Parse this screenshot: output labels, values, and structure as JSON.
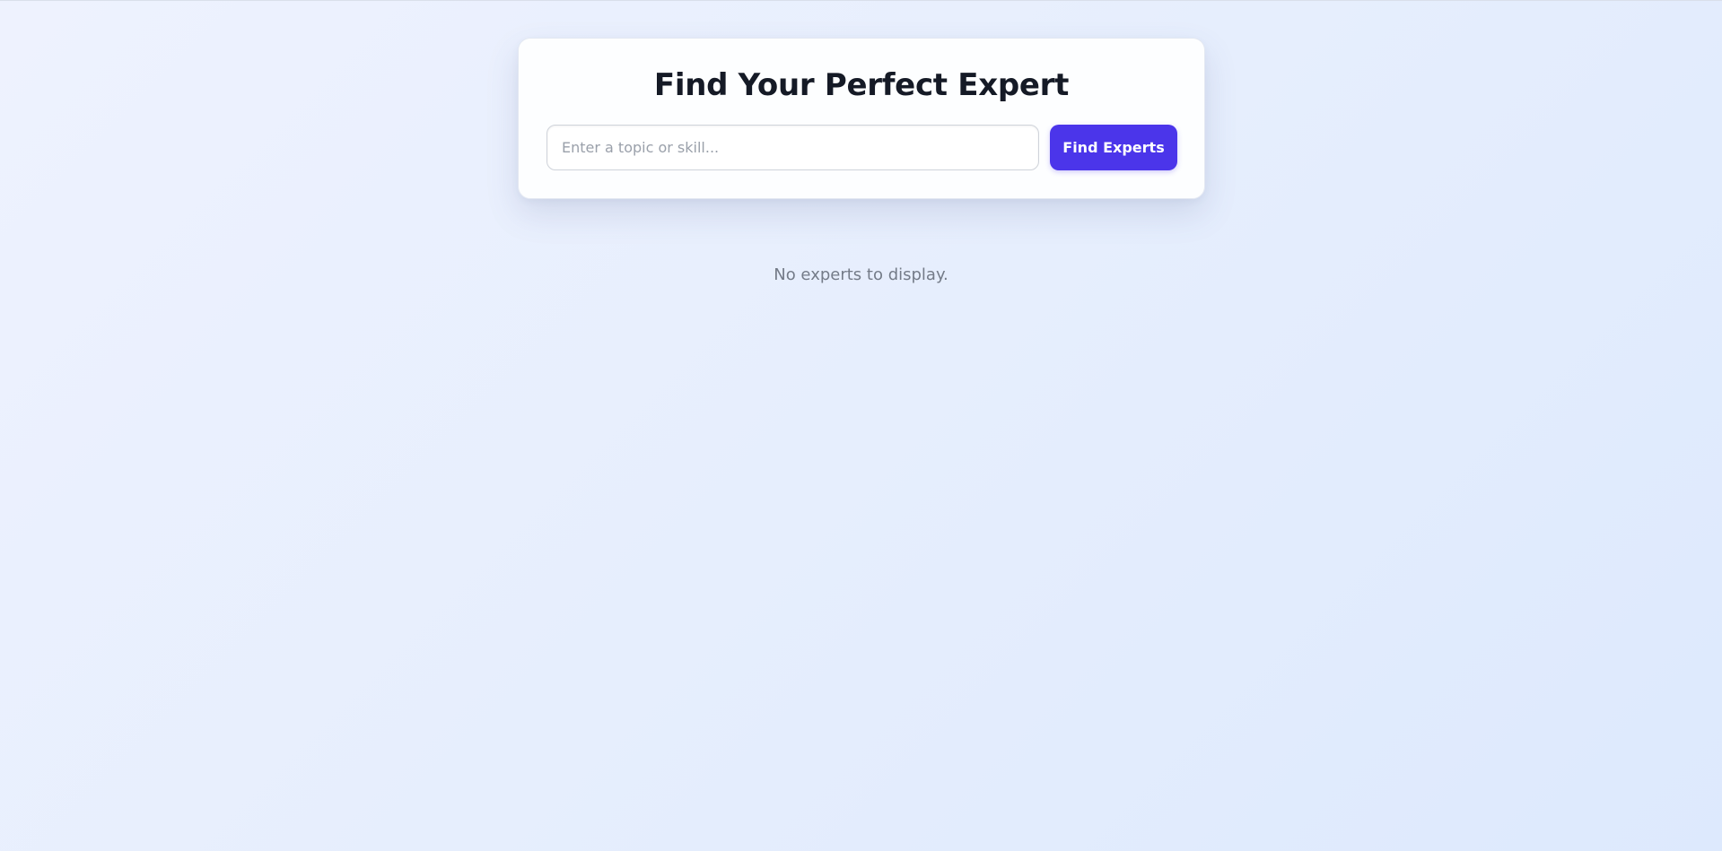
{
  "header": {
    "title": "Find Your Perfect Expert"
  },
  "search": {
    "placeholder": "Enter a topic or skill...",
    "value": "",
    "button_label": "Find Experts"
  },
  "results": {
    "empty_message": "No experts to display."
  },
  "colors": {
    "accent": "#4b35ea",
    "title_text": "#151a26",
    "muted_text": "#747b88",
    "background": "#e6eefd"
  }
}
